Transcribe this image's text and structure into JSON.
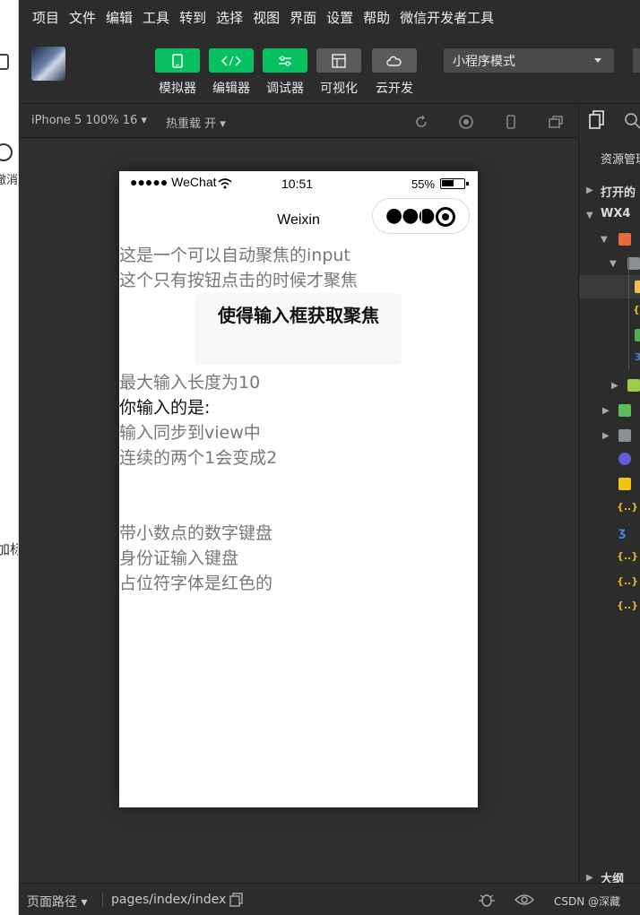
{
  "menubar": {
    "items": [
      "项目",
      "文件",
      "编辑",
      "工具",
      "转到",
      "选择",
      "视图",
      "界面",
      "设置",
      "帮助",
      "微信开发者工具"
    ]
  },
  "toolbar": {
    "tools": [
      {
        "label": "模拟器",
        "icon": "phone-icon",
        "style": "green"
      },
      {
        "label": "编辑器",
        "icon": "code-icon",
        "style": "green"
      },
      {
        "label": "调试器",
        "icon": "debug-sliders-icon",
        "style": "green"
      },
      {
        "label": "可视化",
        "icon": "layout-icon",
        "style": "gray"
      },
      {
        "label": "云开发",
        "icon": "cloud-icon",
        "style": "gray"
      }
    ],
    "mode": "小程序模式"
  },
  "simulator": {
    "device": "iPhone 5 100% 16",
    "hot_reload": "热重载 开"
  },
  "phone": {
    "carrier": "●●●●● WeChat",
    "time": "10:51",
    "battery": "55%",
    "nav_title": "Weixin",
    "lines_top": [
      "这是一个可以自动聚焦的input",
      "这个只有按钮点击的时候才聚焦"
    ],
    "focus_button": "使得输入框获取聚焦",
    "lines_mid": [
      "最大输入长度为10",
      "你输入的是:",
      "输入同步到view中",
      "连续的两个1会变成2"
    ],
    "lines_bottom": [
      "带小数点的数字键盘",
      "身份证输入键盘",
      "占位符字体是红色的"
    ]
  },
  "explorer": {
    "header": "资源管理",
    "open_editors": "打开的",
    "project": "WX4",
    "outline": "大纲"
  },
  "statusbar": {
    "route_label": "页面路径",
    "path": "pages/index/index",
    "watermark": "CSDN @深藏"
  },
  "left_window": {
    "fragment1": "撤消",
    "fragment2": "加标"
  },
  "colors": {
    "accent_green": "#07c160",
    "chrome_dark": "#2c2c2c"
  }
}
